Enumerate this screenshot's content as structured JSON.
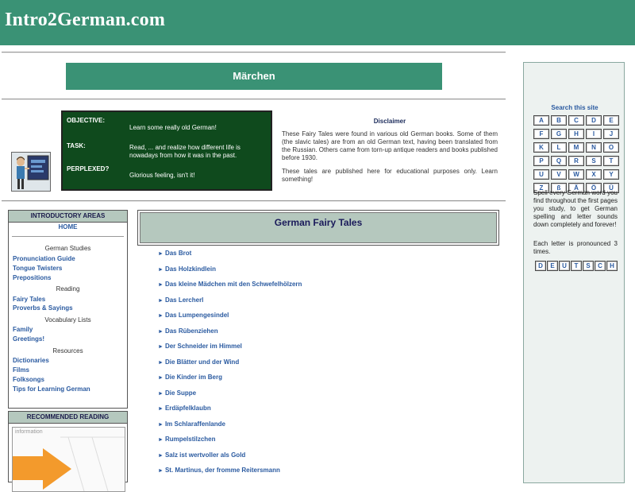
{
  "site_title": "Intro2German.com",
  "page_title": "Märchen",
  "objective_box": {
    "objective_label": "OBJECTIVE:",
    "objective_text": "Learn some really old German!",
    "task_label": "TASK:",
    "task_text": "Read, ... and realize how different life is nowadays from how it was in the past.",
    "perplexed_label": "PERPLEXED?",
    "perplexed_text": "Glorious feeling, isn't it!"
  },
  "disclaimer": {
    "title": "Disclaimer",
    "p1": "These Fairy Tales were found in various old German books. Some of them (the slavic tales) are from an old German text, having been translated from the Russian. Others came from torn-up antique readers and books published before 1930.",
    "p2": "These tales are published here for educational purposes only. Learn something!"
  },
  "search": {
    "title": "Search this site",
    "letters": [
      "A",
      "B",
      "C",
      "D",
      "E",
      "F",
      "G",
      "H",
      "I",
      "J",
      "K",
      "L",
      "M",
      "N",
      "O",
      "P",
      "Q",
      "R",
      "S",
      "T",
      "U",
      "V",
      "W",
      "X",
      "Y",
      "Z",
      "ß",
      "Ä",
      "Ö",
      "Ü"
    ],
    "text1": "Spell every German word you find throughout the first pages you study, to get German spelling and letter sounds down completely and forever!",
    "text2": "Each letter is pronounced 3 times.",
    "deutsch_letters": [
      "D",
      "E",
      "U",
      "T",
      "S",
      "C",
      "H"
    ]
  },
  "nav": {
    "header": "INTRODUCTORY AREAS",
    "home": "HOME",
    "sec_german_studies": "German Studies",
    "pronunciation": "Pronunciation Guide",
    "tongue_twisters": "Tongue Twisters",
    "prepositions": "Prepositions",
    "sec_reading": "Reading",
    "fairy_tales": "Fairy Tales",
    "proverbs": "Proverbs & Sayings",
    "sec_vocab": "Vocabulary Lists",
    "family": "Family",
    "greetings": "Greetings!",
    "sec_resources": "Resources",
    "dictionaries": "Dictionaries",
    "films": "Films",
    "folksongs": "Folksongs",
    "tips": "Tips for Learning German"
  },
  "recommended": {
    "header": "RECOMMENDED READING",
    "caption": "information"
  },
  "fairy_tales": {
    "title": "German Fairy Tales",
    "arrow": "►",
    "items": [
      "Das Brot",
      "Das Holzkindlein",
      "Das kleine Mädchen mit den Schwefelhölzern",
      "Das Lercherl",
      "Das Lumpengesindel",
      "Das Rübenziehen",
      "Der Schneider im Himmel",
      "Die Blätter und der Wind",
      "Die Kinder im Berg",
      "Die Suppe",
      "Erdäpfelklaubn",
      "Im Schlaraffenlande",
      "Rumpelstilzchen",
      "Salz ist wertvoller als Gold",
      "St. Martinus, der fromme Reitersmann"
    ]
  }
}
